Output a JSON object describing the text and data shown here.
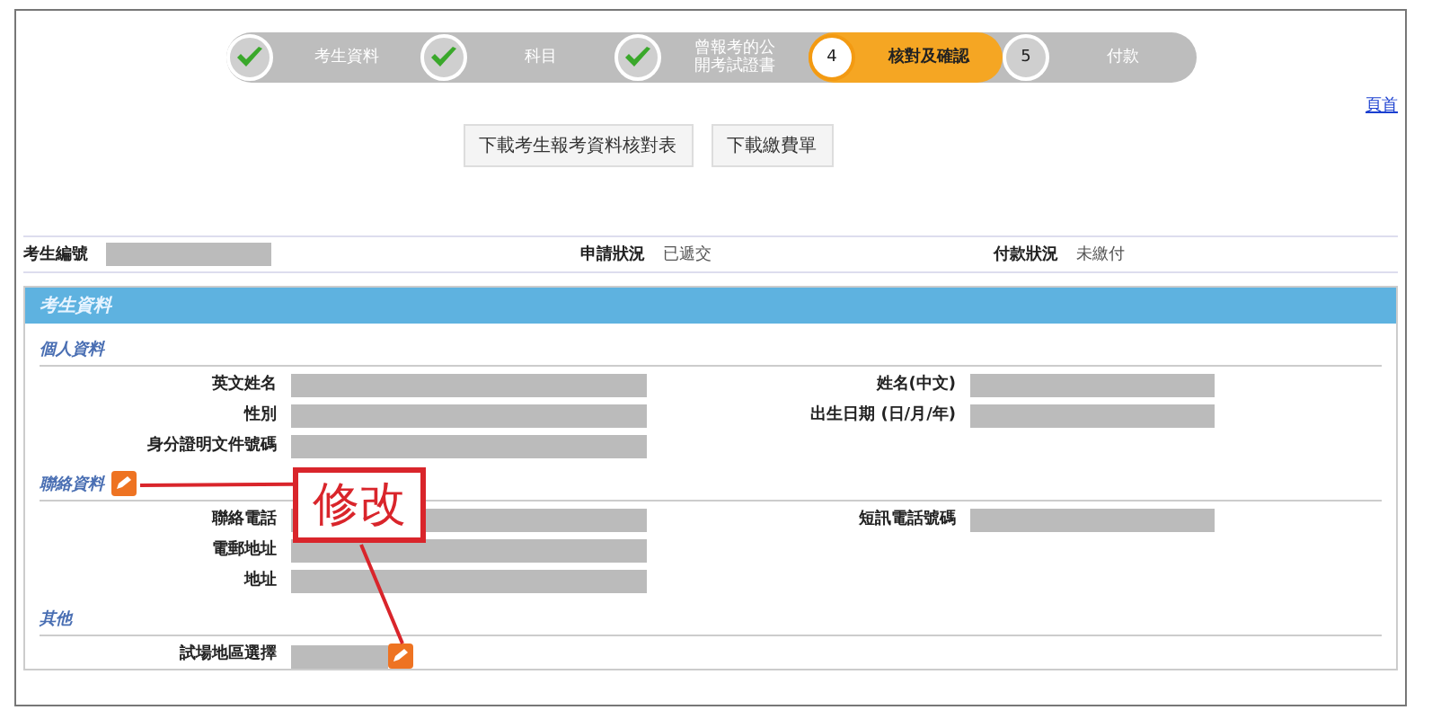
{
  "steps": [
    {
      "label": "考生資料",
      "completed": true,
      "selected": false
    },
    {
      "label": "科目",
      "completed": true,
      "selected": false
    },
    {
      "label": "曾報考的公開考試證書",
      "completed": true,
      "selected": false
    },
    {
      "label": "核對及確認",
      "number": "4",
      "completed": false,
      "selected": true
    },
    {
      "label": "付款",
      "number": "5",
      "completed": false,
      "selected": false
    }
  ],
  "top_link": "頁首",
  "buttons": [
    "下載考生報考資料核對表",
    "下載繳費單"
  ],
  "status_row": [
    {
      "label": "考生編號",
      "kind": "field"
    },
    {
      "label": "申請狀況",
      "value": "已遞交",
      "kind": "text"
    },
    {
      "label": "付款狀況",
      "value": "未繳付",
      "kind": "text"
    }
  ],
  "section": {
    "title": "考生資料",
    "groups": [
      {
        "title": "個人資料",
        "editable": false,
        "rows": [
          {
            "label": "英文姓名",
            "right_label": "姓名(中文)"
          },
          {
            "label": "性別",
            "right_label": "出生日期 (日/月/年)"
          },
          {
            "label": "身分證明文件號碼"
          }
        ]
      },
      {
        "title": "聯絡資料",
        "editable": true,
        "rows": [
          {
            "label": "聯絡電話",
            "right_label": "短訊電話號碼"
          },
          {
            "label": "電郵地址"
          },
          {
            "label": "地址"
          }
        ]
      },
      {
        "title": "其他",
        "editable": false,
        "rows": [
          {
            "label": "試場地區選擇",
            "editable": true
          }
        ]
      }
    ]
  },
  "callout": {
    "text": "修改"
  }
}
